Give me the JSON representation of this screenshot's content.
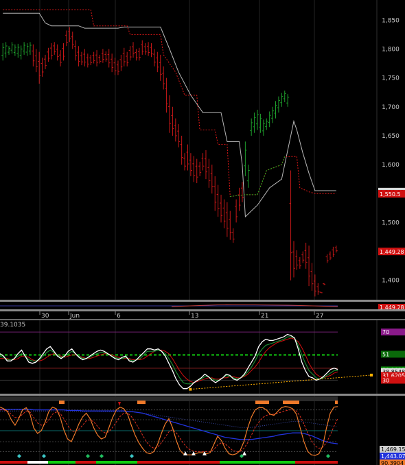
{
  "colors": {
    "up_bar": "#1e9e2c",
    "down_bar": "#c81818",
    "step_line": "#b8b8b8",
    "dotted_red": "#e01818",
    "dotted_green": "#20b020",
    "axis_text": "#c8c8c8",
    "grid": "#242424",
    "white": "#ffffff",
    "red": "#d01010",
    "green": "#11cc11",
    "orange": "#f07a2a",
    "blue": "#2233dd",
    "yellow": "#ffb000"
  },
  "date_labels": [
    "30",
    "Jun",
    "6",
    "13",
    "21",
    "27"
  ],
  "top_indicator_value": "39.1035",
  "chart_data": [
    {
      "type": "candlestick",
      "panel": "price",
      "ylim": [
        1370,
        1880
      ],
      "yticks": [
        1400,
        1450,
        1500,
        1550,
        1600,
        1650,
        1700,
        1750,
        1800,
        1850
      ],
      "ytick_labels": [
        "1,400",
        "1,450",
        "1,500",
        "1,550",
        "1,600",
        "1,650",
        "1,700",
        "1,750",
        "1,800",
        "1,850"
      ],
      "bars_high": [
        1810,
        1812,
        1805,
        1812,
        1808,
        1809,
        1806,
        1812,
        1810,
        1812,
        1808,
        1800,
        1795,
        1785,
        1790,
        1802,
        1810,
        1812,
        1808,
        1798,
        1810,
        1832,
        1838,
        1830,
        1815,
        1805,
        1795,
        1800,
        1792,
        1790,
        1795,
        1798,
        1790,
        1800,
        1796,
        1800,
        1792,
        1785,
        1780,
        1790,
        1802,
        1795,
        1805,
        1812,
        1800,
        1802,
        1815,
        1810,
        1812,
        1810,
        1800,
        1795,
        1790,
        1770,
        1750,
        1720,
        1700,
        1680,
        1670,
        1650,
        1620,
        1635,
        1620,
        1615,
        1610,
        1605,
        1620,
        1625,
        1610,
        1600,
        1580,
        1565,
        1548,
        1540,
        1535,
        1520,
        1490,
        1540,
        1560,
        1570,
        1640,
        1600,
        1680,
        1690,
        1695,
        1688,
        1678,
        1680,
        1692,
        1700,
        1710,
        1718,
        1724,
        1728,
        1722,
        1590,
        1468,
        1452,
        1440,
        1450,
        1465,
        1460,
        1430,
        1410,
        1395,
        1380,
        1395,
        1445,
        1450,
        1458,
        1460
      ],
      "bars_low": [
        1780,
        1785,
        1790,
        1792,
        1788,
        1785,
        1782,
        1790,
        1788,
        1790,
        1770,
        1760,
        1740,
        1752,
        1765,
        1778,
        1782,
        1790,
        1780,
        1770,
        1780,
        1805,
        1812,
        1800,
        1780,
        1770,
        1772,
        1770,
        1768,
        1772,
        1775,
        1770,
        1775,
        1776,
        1778,
        1768,
        1760,
        1755,
        1755,
        1762,
        1770,
        1770,
        1780,
        1785,
        1780,
        1780,
        1790,
        1790,
        1788,
        1786,
        1770,
        1760,
        1745,
        1730,
        1690,
        1655,
        1650,
        1640,
        1630,
        1600,
        1590,
        1590,
        1580,
        1570,
        1568,
        1580,
        1590,
        1575,
        1560,
        1550,
        1520,
        1510,
        1500,
        1490,
        1475,
        1470,
        1465,
        1500,
        1520,
        1535,
        1580,
        1560,
        1650,
        1655,
        1660,
        1655,
        1650,
        1660,
        1665,
        1672,
        1680,
        1690,
        1700,
        1708,
        1700,
        1400,
        1405,
        1418,
        1420,
        1430,
        1420,
        1390,
        1382,
        1372,
        1375,
        1378,
        1392,
        1430,
        1435,
        1440,
        1448
      ],
      "bars_up": [
        true,
        true,
        true,
        true,
        true,
        true,
        true,
        true,
        true,
        true,
        false,
        false,
        false,
        false,
        false,
        false,
        false,
        false,
        false,
        false,
        false,
        false,
        false,
        false,
        false,
        false,
        false,
        false,
        false,
        false,
        false,
        false,
        false,
        false,
        false,
        false,
        false,
        false,
        false,
        false,
        false,
        false,
        false,
        false,
        false,
        false,
        false,
        false,
        false,
        false,
        false,
        false,
        false,
        false,
        false,
        false,
        false,
        false,
        false,
        false,
        false,
        false,
        false,
        false,
        false,
        false,
        false,
        false,
        false,
        false,
        false,
        false,
        false,
        false,
        false,
        false,
        false,
        false,
        false,
        false,
        true,
        true,
        true,
        true,
        true,
        true,
        true,
        true,
        true,
        true,
        true,
        true,
        true,
        true,
        true,
        false,
        false,
        false,
        false,
        false,
        false,
        false,
        false,
        false,
        false,
        false,
        false,
        false,
        false,
        false,
        false
      ],
      "price_labels": [
        {
          "text": "1,552.83",
          "value": 1552.83,
          "style": "grey"
        },
        {
          "text": "1,550.5",
          "value": 1549.0,
          "style": "red"
        },
        {
          "text": "1,449.28",
          "value": 1449.28,
          "style": "red"
        }
      ],
      "step_trail": [
        [
          0,
          1862
        ],
        [
          12,
          1862
        ],
        [
          14,
          1845
        ],
        [
          16,
          1840
        ],
        [
          25,
          1840
        ],
        [
          27,
          1836
        ],
        [
          38,
          1836
        ],
        [
          40,
          1838
        ],
        [
          52,
          1838
        ],
        [
          55,
          1800
        ],
        [
          58,
          1760
        ],
        [
          62,
          1720
        ],
        [
          66,
          1690
        ],
        [
          72,
          1690
        ],
        [
          74,
          1640
        ],
        [
          78,
          1640
        ],
        [
          79,
          1600
        ],
        [
          80,
          1510
        ],
        [
          84,
          1530
        ],
        [
          88,
          1560
        ],
        [
          92,
          1575
        ],
        [
          93,
          1600
        ],
        [
          95,
          1650
        ],
        [
          96,
          1675
        ],
        [
          97,
          1660
        ],
        [
          99,
          1620
        ],
        [
          101,
          1585
        ],
        [
          103,
          1555
        ],
        [
          110,
          1555
        ]
      ],
      "dotted_trail": [
        [
          0,
          1868
        ],
        [
          29,
          1868
        ],
        [
          30,
          1840
        ],
        [
          41,
          1840
        ],
        [
          42,
          1825
        ],
        [
          52,
          1825
        ],
        [
          53,
          1790
        ],
        [
          57,
          1760
        ],
        [
          60,
          1720
        ],
        [
          64,
          1720
        ],
        [
          65,
          1660
        ],
        [
          70,
          1660
        ],
        [
          71,
          1635
        ],
        [
          74,
          1635
        ],
        [
          75,
          1545
        ],
        [
          80,
          1548
        ],
        [
          84,
          1548
        ],
        [
          87,
          1590
        ],
        [
          92,
          1600
        ],
        [
          93,
          1614
        ],
        [
          97,
          1614
        ],
        [
          98,
          1560
        ],
        [
          101,
          1553
        ],
        [
          103,
          1550
        ],
        [
          110,
          1550
        ]
      ]
    },
    {
      "type": "line",
      "panel": "volume-strip",
      "value_label": "1,449.28"
    },
    {
      "type": "line",
      "panel": "oscillator",
      "ylim": [
        20,
        78
      ],
      "levels": [
        {
          "value": 70,
          "label": "70"
        },
        {
          "value": 51,
          "label": "51"
        },
        {
          "value": 30,
          "label": "30"
        }
      ],
      "value_labels": [
        {
          "text": "39.1035",
          "value": 39.1035
        },
        {
          "text": "38.8548",
          "value": 38.8548
        },
        {
          "text": "31.6205",
          "value": 34.0
        }
      ],
      "white_series": [
        52,
        50,
        46,
        46,
        48,
        52,
        55,
        50,
        45,
        44,
        45,
        48,
        52,
        56,
        58,
        54,
        50,
        48,
        50,
        54,
        56,
        52,
        49,
        47,
        48,
        50,
        52,
        54,
        55,
        54,
        52,
        50,
        48,
        47,
        49,
        50,
        46,
        45,
        47,
        50,
        53,
        56,
        56,
        55,
        56,
        54,
        50,
        44,
        38,
        31,
        26,
        23,
        23,
        25,
        28,
        30,
        32,
        35,
        33,
        30,
        28,
        30,
        32,
        35,
        34,
        31,
        30,
        32,
        35,
        40,
        45,
        50,
        58,
        62,
        64,
        63,
        63,
        64,
        65,
        66,
        68,
        67,
        65,
        56,
        45,
        38,
        33,
        32,
        30,
        31,
        33,
        36,
        39,
        40,
        39
      ],
      "red_series": [
        48,
        48,
        48,
        47,
        47,
        48,
        50,
        50,
        49,
        47,
        46,
        46,
        47,
        49,
        51,
        52,
        51,
        50,
        49,
        50,
        51,
        51,
        50,
        49,
        48,
        48,
        49,
        50,
        51,
        52,
        52,
        51,
        50,
        49,
        48,
        48,
        48,
        47,
        47,
        47,
        48,
        50,
        52,
        54,
        55,
        55,
        54,
        52,
        48,
        43,
        38,
        34,
        31,
        29,
        28,
        29,
        30,
        31,
        32,
        32,
        31,
        31,
        32,
        32,
        33,
        33,
        32,
        32,
        33,
        35,
        38,
        41,
        45,
        50,
        54,
        57,
        59,
        61,
        62,
        63,
        64,
        65,
        64,
        62,
        57,
        51,
        44,
        39,
        35,
        33,
        32,
        33,
        34,
        36,
        37
      ],
      "green_series": [
        50,
        49,
        47,
        47,
        48,
        50,
        52,
        50,
        47,
        46,
        46,
        47,
        50,
        53,
        55,
        53,
        51,
        49,
        50,
        52,
        54,
        52,
        50,
        48,
        48,
        49,
        51,
        52,
        53,
        53,
        52,
        50,
        49,
        48,
        48,
        49,
        47,
        46,
        47,
        48,
        51,
        54,
        54,
        54,
        55,
        54,
        52,
        48,
        43,
        37,
        32,
        28,
        27,
        27,
        28,
        30,
        31,
        33,
        33,
        31,
        30,
        30,
        32,
        34,
        33,
        32,
        31,
        32,
        34,
        37,
        41,
        46,
        52,
        56,
        59,
        60,
        61,
        62,
        63,
        64,
        66,
        66,
        65,
        59,
        51,
        44,
        38,
        35,
        32,
        31,
        32,
        34,
        36,
        38,
        38
      ],
      "trendline": {
        "from": [
          53,
          22.5
        ],
        "to": [
          100,
          33.5
        ],
        "color": "#ffb000"
      }
    },
    {
      "type": "line",
      "panel": "cycle",
      "value_labels": [
        {
          "text": "1,469.15",
          "style": "grey"
        },
        {
          "text": "1,443.07",
          "style": "blue"
        },
        {
          "text": "90.3904",
          "style": "orange"
        }
      ],
      "orange_series": [
        93,
        90,
        85,
        70,
        60,
        72,
        88,
        92,
        80,
        55,
        45,
        50,
        65,
        85,
        93,
        90,
        75,
        52,
        35,
        30,
        45,
        62,
        75,
        82,
        72,
        55,
        42,
        35,
        38,
        55,
        74,
        88,
        93,
        90,
        80,
        60,
        42,
        28,
        18,
        10,
        8,
        12,
        25,
        45,
        62,
        72,
        55,
        32,
        14,
        7,
        6,
        6,
        8,
        10,
        10,
        8,
        10,
        25,
        40,
        32,
        18,
        8,
        6,
        8,
        14,
        30,
        55,
        75,
        88,
        92,
        92,
        88,
        80,
        78,
        85,
        92,
        94,
        93,
        90,
        80,
        55,
        30,
        12,
        6,
        5,
        8,
        22,
        55,
        82,
        93,
        94
      ],
      "red_dashed_series": [
        88,
        88,
        86,
        80,
        74,
        74,
        80,
        86,
        84,
        74,
        64,
        60,
        62,
        70,
        80,
        84,
        82,
        72,
        60,
        50,
        48,
        52,
        60,
        68,
        70,
        66,
        58,
        50,
        46,
        48,
        56,
        66,
        76,
        82,
        82,
        76,
        66,
        54,
        42,
        30,
        22,
        18,
        20,
        28,
        38,
        48,
        52,
        46,
        36,
        26,
        18,
        14,
        12,
        12,
        12,
        12,
        12,
        16,
        24,
        28,
        26,
        20,
        14,
        12,
        12,
        18,
        28,
        42,
        56,
        66,
        74,
        78,
        80,
        80,
        82,
        84,
        86,
        88,
        88,
        86,
        76,
        62,
        46,
        32,
        22,
        18,
        20,
        28,
        42,
        58,
        72
      ],
      "blue_series": [
        89,
        89,
        89,
        89,
        89,
        89,
        89,
        89,
        89,
        88,
        88,
        88,
        88,
        88,
        88,
        88,
        88,
        88,
        87,
        87,
        87,
        87,
        86,
        86,
        86,
        86,
        86,
        86,
        86,
        86,
        86,
        86,
        86,
        86,
        85,
        85,
        84,
        83,
        82,
        80,
        78,
        76,
        74,
        72,
        70,
        68,
        66,
        64,
        62,
        60,
        58,
        56,
        54,
        52,
        50,
        48,
        46,
        44,
        42,
        40,
        38,
        37,
        36,
        35,
        34,
        34,
        34,
        34,
        35,
        36,
        37,
        38,
        39,
        40,
        42,
        43,
        44,
        45,
        46,
        46,
        46,
        45,
        43,
        41,
        38,
        35,
        32,
        30,
        28,
        27,
        26
      ],
      "blue_dotted_series": [
        86,
        86,
        86,
        86,
        86,
        86,
        86,
        86,
        86,
        86,
        86,
        86,
        86,
        86,
        86,
        86,
        86,
        86,
        86,
        86,
        85,
        85,
        85,
        85,
        85,
        85,
        85,
        85,
        85,
        85,
        85,
        85,
        85,
        85,
        84,
        84,
        84,
        83,
        82,
        81,
        80,
        79,
        78,
        77,
        76,
        75,
        74,
        73,
        72,
        71,
        70,
        69,
        68,
        67,
        66,
        65,
        64,
        63,
        62,
        61,
        60,
        59,
        58,
        57,
        56,
        56,
        56,
        56,
        57,
        58,
        59,
        60,
        61,
        62,
        63,
        64,
        65,
        66,
        67,
        67,
        67,
        66,
        65,
        64,
        63,
        62,
        61,
        60,
        59,
        58,
        57
      ]
    }
  ]
}
